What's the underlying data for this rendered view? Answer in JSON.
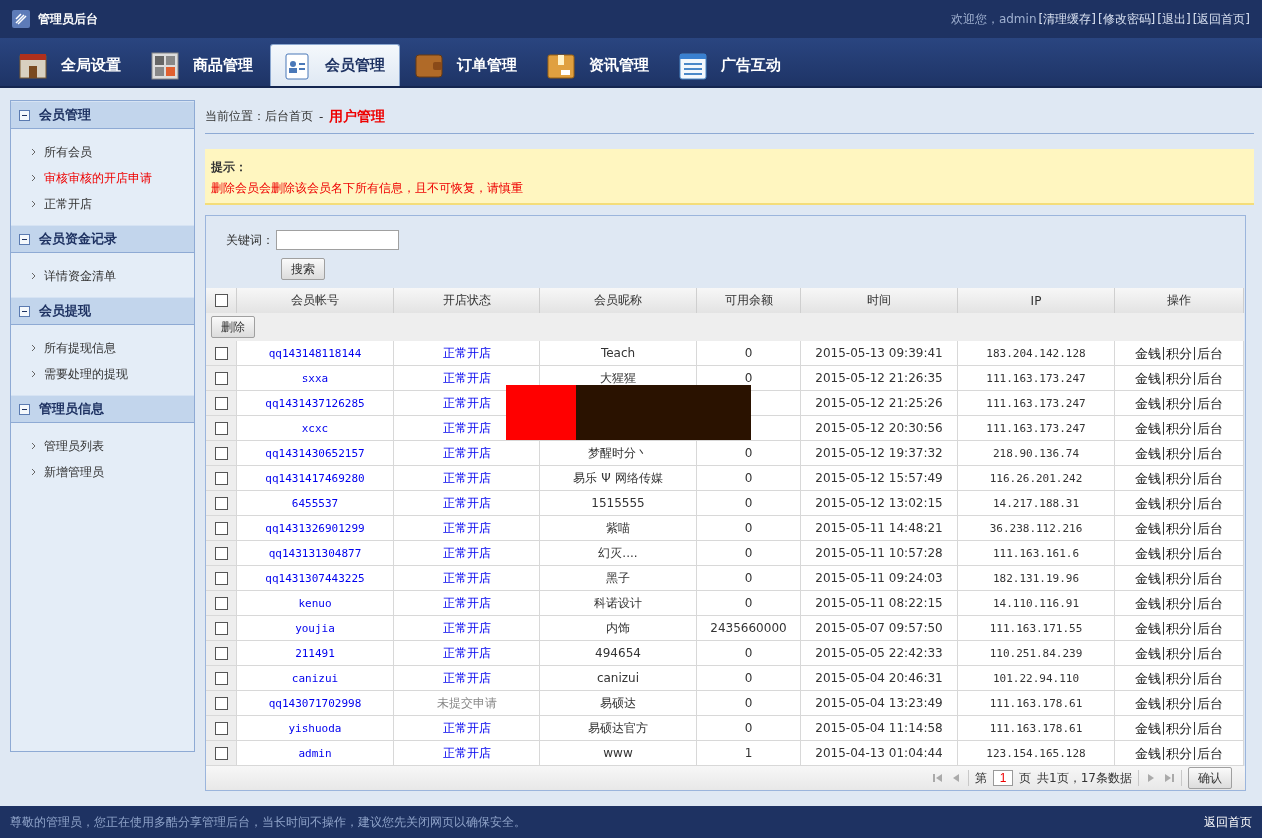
{
  "top_bar": {
    "title": "管理员后台",
    "welcome": "欢迎您，admin",
    "links": [
      "[清理缓存]",
      "[修改密码]",
      "[退出]",
      "[返回首页]"
    ]
  },
  "nav_tabs": [
    {
      "label": "全局设置",
      "kind": "store",
      "selected": false
    },
    {
      "label": "商品管理",
      "kind": "grid",
      "selected": false
    },
    {
      "label": "会员管理",
      "kind": "member",
      "selected": true
    },
    {
      "label": "订单管理",
      "kind": "wallet",
      "selected": false
    },
    {
      "label": "资讯管理",
      "kind": "box",
      "selected": false
    },
    {
      "label": "广告互动",
      "kind": "list",
      "selected": false
    }
  ],
  "sidebar": [
    {
      "title": "会员管理",
      "items": [
        {
          "label": "所有会员",
          "selected": false
        },
        {
          "label": "审核审核的开店申请",
          "selected": true
        },
        {
          "label": "正常开店",
          "selected": false
        }
      ]
    },
    {
      "title": "会员资金记录",
      "items": [
        {
          "label": "详情资金清单",
          "selected": false
        }
      ]
    },
    {
      "title": "会员提现",
      "items": [
        {
          "label": "所有提现信息",
          "selected": false
        },
        {
          "label": "需要处理的提现",
          "selected": false
        }
      ]
    },
    {
      "title": "管理员信息",
      "items": [
        {
          "label": "管理员列表",
          "selected": false
        },
        {
          "label": "新增管理员",
          "selected": false
        }
      ]
    }
  ],
  "breadcrumb": {
    "prefix": "当前位置：后台首页",
    "separator": "-",
    "current": "用户管理"
  },
  "notice": {
    "title": "提示：",
    "text": "删除会员会删除该会员名下所有信息，且不可恢复，请慎重"
  },
  "search": {
    "label": "关键词：",
    "button": "搜索"
  },
  "table": {
    "columns": [
      "会员帐号",
      "开店状态",
      "会员昵称",
      "可用余额",
      "时间",
      "IP",
      "操作"
    ],
    "select_all": false,
    "delete_button": "删除",
    "rows": [
      {
        "checked": false,
        "account": "qq143148118144",
        "status": "正常开店",
        "kind": "open",
        "nickname": "Teach",
        "balance": "0",
        "time": "2015-05-13 09:39:41",
        "ip": "183.204.142.128",
        "actions": [
          "金钱",
          "积分",
          "后台"
        ]
      },
      {
        "checked": false,
        "account": "sxxa",
        "status": "正常开店",
        "kind": "open",
        "nickname": "大猩猩",
        "balance": "0",
        "time": "2015-05-12 21:26:35",
        "ip": "111.163.173.247",
        "actions": [
          "金钱",
          "积分",
          "后台"
        ]
      },
      {
        "checked": false,
        "account": "qq1431437126285",
        "status": "正常开店",
        "kind": "open",
        "time": "2015-05-12 21:25:26",
        "ip": "111.163.173.247",
        "actions": [
          "金钱",
          "积分",
          "后台"
        ]
      },
      {
        "checked": false,
        "account": "xcxc",
        "status": "正常开店",
        "kind": "open",
        "time": "2015-05-12 20:30:56",
        "ip": "111.163.173.247",
        "actions": [
          "金钱",
          "积分",
          "后台"
        ]
      },
      {
        "checked": false,
        "account": "qq1431430652157",
        "status": "正常开店",
        "kind": "open",
        "nickname": "梦醒时分丶",
        "balance": "0",
        "time": "2015-05-12 19:37:32",
        "ip": "218.90.136.74",
        "actions": [
          "金钱",
          "积分",
          "后台"
        ]
      },
      {
        "checked": false,
        "account": "qq1431417469280",
        "status": "正常开店",
        "kind": "open",
        "nickname": "易乐 Ψ 网络传媒",
        "balance": "0",
        "time": "2015-05-12 15:57:49",
        "ip": "116.26.201.242",
        "actions": [
          "金钱",
          "积分",
          "后台"
        ]
      },
      {
        "checked": false,
        "account": "6455537",
        "status": "正常开店",
        "kind": "open",
        "nickname": "1515555",
        "balance": "0",
        "time": "2015-05-12 13:02:15",
        "ip": "14.217.188.31",
        "actions": [
          "金钱",
          "积分",
          "后台"
        ]
      },
      {
        "checked": false,
        "account": "qq1431326901299",
        "status": "正常开店",
        "kind": "open",
        "nickname": "紫喵",
        "balance": "0",
        "time": "2015-05-11 14:48:21",
        "ip": "36.238.112.216",
        "actions": [
          "金钱",
          "积分",
          "后台"
        ]
      },
      {
        "checked": false,
        "account": "qq143131304877",
        "status": "正常开店",
        "kind": "open",
        "nickname": "幻灭....",
        "balance": "0",
        "time": "2015-05-11 10:57:28",
        "ip": "111.163.161.6",
        "actions": [
          "金钱",
          "积分",
          "后台"
        ]
      },
      {
        "checked": false,
        "account": "qq1431307443225",
        "status": "正常开店",
        "kind": "open",
        "nickname": "黑子",
        "balance": "0",
        "time": "2015-05-11 09:24:03",
        "ip": "182.131.19.96",
        "actions": [
          "金钱",
          "积分",
          "后台"
        ]
      },
      {
        "checked": false,
        "account": "kenuo",
        "status": "正常开店",
        "kind": "open",
        "nickname": "科诺设计",
        "balance": "0",
        "time": "2015-05-11 08:22:15",
        "ip": "14.110.116.91",
        "actions": [
          "金钱",
          "积分",
          "后台"
        ]
      },
      {
        "checked": false,
        "account": "youjia",
        "status": "正常开店",
        "kind": "open",
        "nickname": "内饰",
        "balance": "2435660000",
        "time": "2015-05-07 09:57:50",
        "ip": "111.163.171.55",
        "actions": [
          "金钱",
          "积分",
          "后台"
        ]
      },
      {
        "checked": false,
        "account": "211491",
        "status": "正常开店",
        "kind": "open",
        "nickname": "494654",
        "balance": "0",
        "time": "2015-05-05 22:42:33",
        "ip": "110.251.84.239",
        "actions": [
          "金钱",
          "积分",
          "后台"
        ]
      },
      {
        "checked": false,
        "account": "canizui",
        "status": "正常开店",
        "kind": "open",
        "nickname": "canizui",
        "balance": "0",
        "time": "2015-05-04 20:46:31",
        "ip": "101.22.94.110",
        "actions": [
          "金钱",
          "积分",
          "后台"
        ]
      },
      {
        "checked": false,
        "account": "qq143071702998",
        "status": "未提交申请",
        "kind": "pending",
        "nickname": "易硕达",
        "balance": "0",
        "time": "2015-05-04 13:23:49",
        "ip": "111.163.178.61",
        "actions": [
          "金钱",
          "积分",
          "后台"
        ]
      },
      {
        "checked": false,
        "account": "yishuoda",
        "status": "正常开店",
        "kind": "open",
        "nickname": "易硕达官方",
        "balance": "0",
        "time": "2015-05-04 11:14:58",
        "ip": "111.163.178.61",
        "actions": [
          "金钱",
          "积分",
          "后台"
        ]
      },
      {
        "checked": false,
        "account": "admin",
        "status": "正常开店",
        "kind": "open",
        "nickname": "www",
        "balance": "1",
        "time": "2015-04-13 01:04:44",
        "ip": "123.154.165.128",
        "actions": [
          "金钱",
          "积分",
          "后台"
        ]
      }
    ]
  },
  "pagination": {
    "prefix": "第",
    "page": "1",
    "suffix": "页",
    "summary": "共1页，17条数据",
    "confirm": "确认"
  },
  "footer": {
    "text": "尊敬的管理员，您正在使用多酷分享管理后台，当长时间不操作，建议您先关闭网页以确保安全。",
    "link": "返回首页"
  }
}
